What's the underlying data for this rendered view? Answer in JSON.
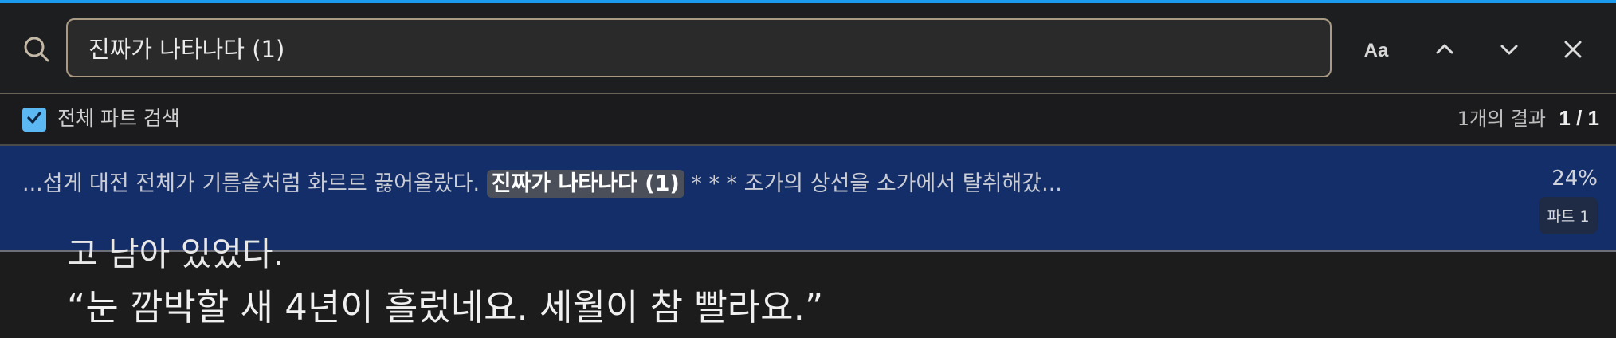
{
  "search": {
    "query": "진짜가 나타나다 (1)",
    "case_sensitive_label": "Aa",
    "icons": {
      "search": "search-icon",
      "prev": "chevron-up-icon",
      "next": "chevron-down-icon",
      "close": "close-icon"
    }
  },
  "options": {
    "search_all_parts_label": "전체 파트 검색",
    "search_all_parts_checked": true,
    "result_count_label": "1개의 결과",
    "result_index": "1 / 1"
  },
  "results": [
    {
      "before": "...섭게 대전 전체가 기름솥처럼 화르르 끓어올랐다. ",
      "match": "진짜가 나타나다 (1)",
      "after": " * * * 조가의 상선을 소가에서 탈취해갔...",
      "percent": "24%",
      "part": "파트 1"
    }
  ],
  "reading": {
    "partial_line": "고 남아 있었다.",
    "line": "“눈 깜박할 새 4년이 흘렀네요. 세월이 참 빨라요.”"
  },
  "colors": {
    "accent": "#1a9bf0",
    "selected_result_bg": "#132e69",
    "checkbox": "#5bb8f2",
    "input_border": "#a99a84"
  }
}
